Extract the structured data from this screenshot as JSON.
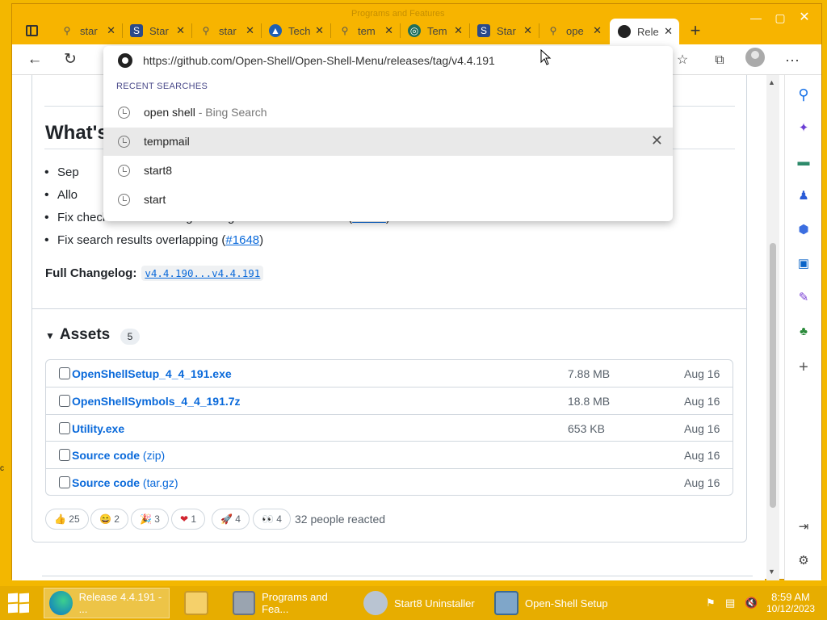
{
  "window": {
    "title": "Programs and Features",
    "controls": {
      "minimize": "—",
      "maximize": "▢",
      "close": "✕"
    }
  },
  "tabs": [
    {
      "label": "star",
      "icon": "search-icon"
    },
    {
      "label": "Star",
      "icon": "startisback-icon"
    },
    {
      "label": "star",
      "icon": "search-icon"
    },
    {
      "label": "Tech",
      "icon": "tech-icon"
    },
    {
      "label": "tem",
      "icon": "search-icon"
    },
    {
      "label": "Tem",
      "icon": "tempmail-icon"
    },
    {
      "label": "Star",
      "icon": "startisback-icon"
    },
    {
      "label": "ope",
      "icon": "search-icon"
    },
    {
      "label": "Rele",
      "icon": "github-icon"
    }
  ],
  "omnibox": {
    "url": "https://github.com/Open-Shell/Open-Shell-Menu/releases/tag/v4.4.191",
    "section_label": "RECENT SEARCHES",
    "suggestions": [
      {
        "text": "open shell",
        "engine": " - Bing Search"
      },
      {
        "text": "tempmail",
        "engine": ""
      },
      {
        "text": "start8",
        "engine": ""
      },
      {
        "text": "start",
        "engine": ""
      }
    ]
  },
  "page": {
    "heading": "What's Changed",
    "bullets": [
      {
        "text": "Sep",
        "link": ""
      },
      {
        "text": "Allo",
        "link": ""
      },
      {
        "text": "Fix checkboxes in settings dialog with custom themes (",
        "link": "#1650",
        "after": ")"
      },
      {
        "text": "Fix search results overlapping (",
        "link": "#1648",
        "after": ")"
      }
    ],
    "changelog_label": "Full Changelog:",
    "changelog_link": "v4.4.190...v4.4.191",
    "assets_title": "Assets",
    "assets_count": "5",
    "assets": [
      {
        "name": "OpenShellSetup_4_4_191.exe",
        "sub": "",
        "size": "7.88 MB",
        "date": "Aug 16"
      },
      {
        "name": "OpenShellSymbols_4_4_191.7z",
        "sub": "",
        "size": "18.8 MB",
        "date": "Aug 16"
      },
      {
        "name": "Utility.exe",
        "sub": "",
        "size": "653 KB",
        "date": "Aug 16"
      },
      {
        "name": "Source code",
        "sub": " (zip)",
        "size": "",
        "date": "Aug 16"
      },
      {
        "name": "Source code",
        "sub": " (tar.gz)",
        "size": "",
        "date": "Aug 16"
      }
    ],
    "reactions": [
      {
        "emoji": "👍",
        "count": "25"
      },
      {
        "emoji": "😄",
        "count": "2"
      },
      {
        "emoji": "🎉",
        "count": "3"
      },
      {
        "emoji": "❤",
        "count": "1"
      },
      {
        "emoji": "🚀",
        "count": "4"
      },
      {
        "emoji": "👀",
        "count": "4"
      }
    ],
    "reacted_text": "32 people reacted"
  },
  "taskbar": {
    "items": [
      {
        "label": "Release 4.4.191 - ...",
        "active": true
      },
      {
        "label": "",
        "active": false
      },
      {
        "label": "Programs and Fea...",
        "active": false
      },
      {
        "label": "Start8 Uninstaller",
        "active": false
      },
      {
        "label": "Open-Shell Setup",
        "active": false
      }
    ],
    "time": "8:59 AM",
    "date": "10/12/2023"
  },
  "colors": {
    "accent": "#f7b400",
    "link": "#0969da"
  }
}
